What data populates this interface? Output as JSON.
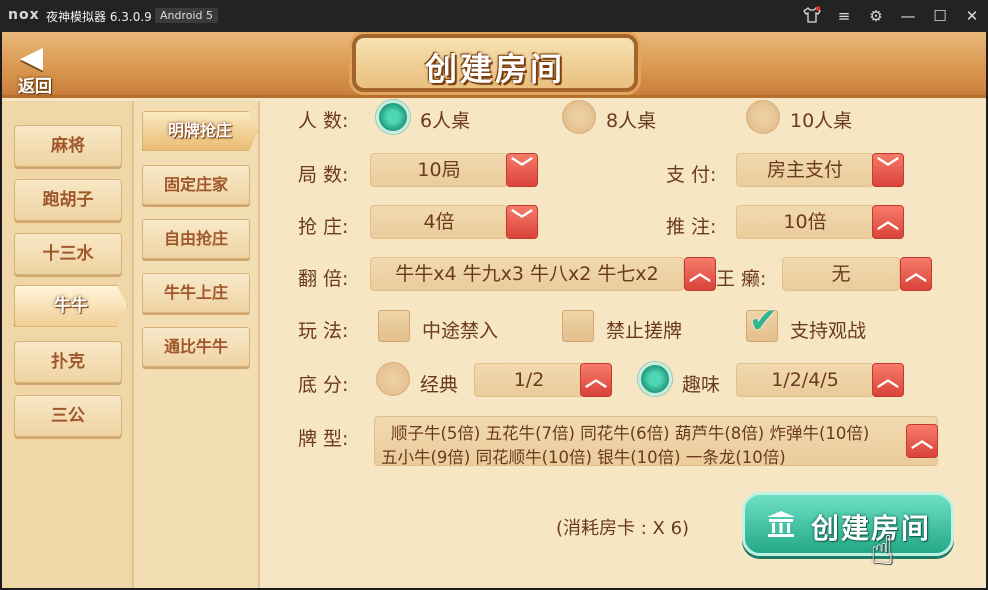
{
  "titlebar": {
    "logo": "nox",
    "app_title": "夜神模拟器 6.3.0.9",
    "android_version": "Android 5",
    "controls": {
      "shirt": "shirt-icon",
      "menu": "menu-icon",
      "settings": "gear-icon",
      "minimize": "minimize-icon",
      "maximize": "maximize-icon",
      "close": "close-icon"
    }
  },
  "header": {
    "back_label": "返回",
    "title": "创建房间"
  },
  "games": [
    {
      "label": "麻将",
      "active": false
    },
    {
      "label": "跑胡子",
      "active": false
    },
    {
      "label": "十三水",
      "active": false
    },
    {
      "label": "牛牛",
      "active": true
    },
    {
      "label": "扑克",
      "active": false
    },
    {
      "label": "三公",
      "active": false
    }
  ],
  "modes": [
    {
      "label": "明牌抢庄",
      "active": true
    },
    {
      "label": "固定庄家",
      "active": false
    },
    {
      "label": "自由抢庄",
      "active": false
    },
    {
      "label": "牛牛上庄",
      "active": false
    },
    {
      "label": "通比牛牛",
      "active": false
    }
  ],
  "form": {
    "players": {
      "label": "人  数:",
      "options": [
        {
          "label": "6人桌",
          "selected": true
        },
        {
          "label": "8人桌",
          "selected": false
        },
        {
          "label": "10人桌",
          "selected": false
        }
      ]
    },
    "rounds": {
      "label": "局  数:",
      "value": "10局"
    },
    "payment": {
      "label": "支  付:",
      "value": "房主支付"
    },
    "grab": {
      "label": "抢  庄:",
      "value": "4倍"
    },
    "push": {
      "label": "推  注:",
      "value": "10倍"
    },
    "multiplier": {
      "label": "翻  倍:",
      "value": "牛牛x4 牛九x3 牛八x2 牛七x2"
    },
    "laizi": {
      "label": "王  癞:",
      "value": "无"
    },
    "rules": {
      "label": "玩  法:",
      "options": [
        {
          "label": "中途禁入",
          "checked": false
        },
        {
          "label": "禁止搓牌",
          "checked": false
        },
        {
          "label": "支持观战",
          "checked": true
        }
      ]
    },
    "base": {
      "label": "底  分:",
      "classic": {
        "label": "经典",
        "selected": false,
        "value": "1/2"
      },
      "fun": {
        "label": "趣味",
        "selected": true,
        "value": "1/2/4/5"
      }
    },
    "card_types": {
      "label": "牌  型:",
      "line1": "顺子牛(5倍) 五花牛(7倍) 同花牛(6倍) 葫芦牛(8倍) 炸弹牛(10倍)",
      "line2": "五小牛(9倍) 同花顺牛(10倍) 银牛(10倍) 一条龙(10倍)"
    }
  },
  "cost_text": "(消耗房卡 : X 6)",
  "create_button": "创建房间",
  "colors": {
    "accent_teal": "#23a888",
    "dropdown_red": "#d9433a",
    "text_brown": "#6b3a1e",
    "panel_bg": "#f6e6c4"
  }
}
